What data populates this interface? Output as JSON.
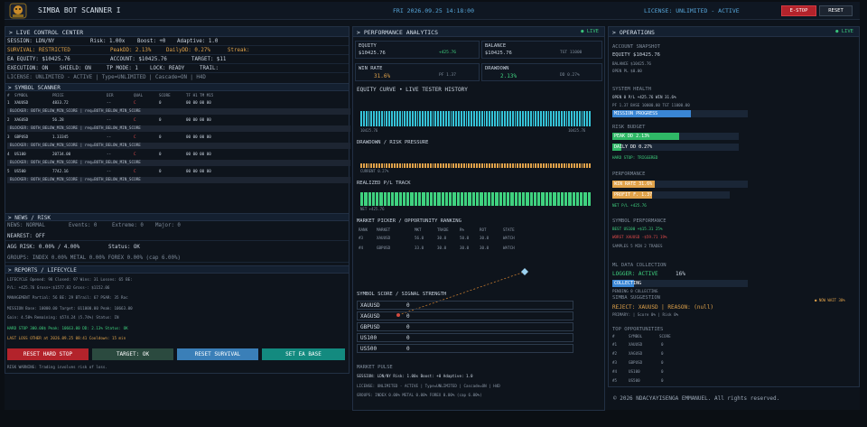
{
  "topbar": {
    "title": "SIMBA BOT SCANNER I",
    "clock": "FRI  2026.09.25  14:18:00",
    "license": "LICENSE: UNLIMITED - ACTIVE",
    "estop_label": "E-STOP",
    "reset_label": "RESET"
  },
  "live_control": {
    "header": "LIVE CONTROL CENTER",
    "session": "SESSION: LDN/NY",
    "risk": "Risk: 1.00x",
    "boost": "Boost: +0",
    "adaptive": "Adaptive: 1.0",
    "survival_label": "SURVIVAL:",
    "survival_value": "RESTRICTED",
    "peakdd": "PeakDD: 2.13%",
    "dailydd": "DailyDD: 0.27%",
    "streak": "Streak:",
    "ea_equity": "EA EQUITY: $10425.76",
    "account": "ACCOUNT: $10425.76",
    "target": "TARGET: $11",
    "execution": "EXECUTION: ON",
    "shield": "SHIELD: ON",
    "tp_mode": "TP MODE: 1",
    "lock": "LOCK: READY",
    "trail": "TRAIL:",
    "license_line": "LICENSE: UNLIMITED - ACTIVE | Type=UNLIMITED | Cascade=ON | H4D"
  },
  "symbol_scanner": {
    "header": "SYMBOL SCANNER",
    "columns": [
      "#",
      "SYMBOL",
      "PRICE",
      "DIR",
      "QUAL",
      "SCORE",
      "TF H1 TM M15"
    ],
    "rows": [
      {
        "n": "1",
        "symbol": "XAUUSD",
        "price": "4833.72",
        "dir": "--",
        "qual": "C",
        "score": "0",
        "tf": "00 00 00 00",
        "blocker": "BLOCKER: BOTH_BELOW_MIN_SCORE | req=BOTH_BELOW_MIN_SCORE"
      },
      {
        "n": "2",
        "symbol": "XAGUSD",
        "price": "56.28",
        "dir": "--",
        "qual": "C",
        "score": "0",
        "tf": "00 00 00 00",
        "blocker": "BLOCKER: BOTH_BELOW_MIN_SCORE | req=BOTH_BELOW_MIN_SCORE"
      },
      {
        "n": "3",
        "symbol": "GBPUSD",
        "price": "1.33345",
        "dir": "--",
        "qual": "C",
        "score": "0",
        "tf": "00 00 00 00",
        "blocker": "BLOCKER: BOTH_BELOW_MIN_SCORE | req=BOTH_BELOW_MIN_SCORE"
      },
      {
        "n": "4",
        "symbol": "US100",
        "price": "20734.00",
        "dir": "--",
        "qual": "C",
        "score": "0",
        "tf": "00 00 00 00",
        "blocker": "BLOCKER: BOTH_BELOW_MIN_SCORE | req=BOTH_BELOW_MIN_SCORE"
      },
      {
        "n": "5",
        "symbol": "US500",
        "price": "7742.16",
        "dir": "--",
        "qual": "C",
        "score": "0",
        "tf": "00 00 00 00",
        "blocker": "BLOCKER: BOTH_BELOW_MIN_SCORE | req=BOTH_BELOW_MIN_SCORE"
      }
    ]
  },
  "news": {
    "header": "NEWS / RISK",
    "news": "NEWS: NORMAL",
    "events": "Events: 0",
    "extreme": "Extreme: 0",
    "major": "Major: 0",
    "nearest": "NEAREST: OFF",
    "agg": "AGG RISK: 0.00% / 4.00%",
    "status": "Status: OK",
    "groups": "GROUPS: INDEX 0.00%   METAL 0.00%   FOREX 0.00%     (cap 6.00%)"
  },
  "reports": {
    "header": "REPORTS / LIFECYCLE",
    "lines": [
      "LIFECYCLE   Opened: 98    Closed: 97    Wins: 31    Losses: 65    BE:",
      "            P/L: +425.76     Gross+:$1577.82    Gross-: $1152.06",
      "MANAGEMENT    Partial: 56    BE: 29    BTrail: 67    PSAR: 35    Roc",
      "MISSION   Base: 10000.00    Target: 011000.00    Peak: 10663.00",
      "          Gain: 4.58%    Remaining: $574.24 (5.74%)    Status: IN",
      "HARD STOP    300.00$    Peak: 10663.00   DD: 2.13%    Status: OK"
    ],
    "last_loss": "LAST LOSS      OTHER at 2026.09.25 08:41      Cooldown: 15 min",
    "buttons": [
      "RESET HARD STOP",
      "TARGET: OK",
      "RESET SURVIVAL",
      "SET EA BASE"
    ],
    "warning": "RISK WARNING: Trading involves risk of loss."
  },
  "performance": {
    "header": "PERFORMANCE ANALYTICS",
    "live": "● LIVE",
    "equity_label": "EQUITY",
    "equity_value": "$10425.76",
    "equity_delta": "+425.76",
    "balance_label": "BALANCE",
    "balance_value": "$10425.76",
    "balance_sub": "TGT 11000",
    "winrate_label": "WIN RATE",
    "winrate_value": "31.6%",
    "winrate_sub": "PF 1.37",
    "drawdown_label": "DRAWDOWN",
    "drawdown_value": "2.13%",
    "drawdown_sub": "DD 0.27%",
    "equity_curve": "EQUITY CURVE  •  LIVE TESTER HISTORY",
    "curve_left": "10425.76",
    "curve_right": "10425.76",
    "drawdown_title": "DRAWDOWN / RISK PRESSURE",
    "drawdown_current": "CURRENT 0.27%",
    "pl_title": "REALIZED P/L TRACK",
    "pl_value": "NET +425.76",
    "ranking_title": "MARKET PICKER / OPPORTUNITY RANKING",
    "ranking_cols": [
      "RANK",
      "MARKET",
      "MKT",
      "TRADE",
      "R%",
      "ROT",
      "STATE"
    ],
    "ranking_rows": [
      [
        "#3",
        "XAUUSD",
        "56.0",
        "30.0",
        "50.0",
        "30.0",
        "WATCH"
      ],
      [
        "#4",
        "GBPUSD",
        "33.0",
        "30.0",
        "30.0",
        "30.0",
        "WATCH"
      ]
    ],
    "signal_title": "SYMBOL SCORE / SIGNAL STRENGTH",
    "signals": [
      {
        "symbol": "XAUUSD",
        "value": "0"
      },
      {
        "symbol": "XAGUSD",
        "value": "0"
      },
      {
        "symbol": "GBPUSD",
        "value": "0"
      },
      {
        "symbol": "US100",
        "value": "0"
      },
      {
        "symbol": "US500",
        "value": "0"
      }
    ],
    "pulse_title": "MARKET PULSE",
    "pulse_session": "SESSION: LDN/NY        Risk: 1.00x    Boost: +0    Adaptive: 1.0",
    "pulse_license": "LICENSE: UNLIMITED - ACTIVE | Type=UNLIMITED | Cascade=ON | H4D",
    "pulse_groups": "GROUPS: INDEX 0.00%   METAL 0.00%   FOREX 0.00%     (cap 6.00%)"
  },
  "operations": {
    "header": "OPERATIONS",
    "live": "● LIVE",
    "snapshot_title": "ACCOUNT SNAPSHOT",
    "equity": "EQUITY     $10425.76",
    "balance": "BALANCE    $10425.76",
    "open": "OPEN PL    $0.00",
    "health_title": "SYSTEM HEALTH",
    "health_line": "OPEN 0   P/L +425.76   WIN 31.6%",
    "health_line2": "PF 1.37     BASE 10000.00    TGT 11000.00",
    "mission_bar": "MISSION PROGRESS",
    "mission_pct": 0.58,
    "risk_title": "RISK BUDGET",
    "peak_dd": "PEAK DD    2.13%",
    "peak_pct": 0.53,
    "daily_dd": "DAILY DD   0.27%",
    "daily_pct": 0.07,
    "hard_stop": "HARD STOP: TRIGGERED",
    "perf_title": "PERFORMANCE",
    "win_rate": "WIN RATE   31.6%",
    "win_pct": 0.316,
    "pf": "PROFIT F.  1.37",
    "pf_pct": 0.34,
    "net": "NET P/L   +425.76",
    "symperf_title": "SYMBOL PERFORMANCE",
    "best": "BEST    US100     +$15.31    25%",
    "worst": "WORST   XAUUSD    -$59.71    19%",
    "samples": "SAMPLES 5    MIN 2 TRADES",
    "ml_title": "ML DATA COLLECTION",
    "logger": "LOGGER: ACTIVE",
    "logger_pct_text": "16%",
    "logger_pct": 0.16,
    "ml_bar": "COLLECTING",
    "ml_sub": "PENDING   0      COLLECTING",
    "suggestion_title": "SIMBA SUGGESTION",
    "suggestion_badge": "● NOW  WAIT 30%",
    "reject": "REJECT: XAUUSD | REASON: (null)",
    "primary": "PRIMARY: | Score 0% | Risk 0%",
    "top_title": "TOP OPPORTUNITIES",
    "top_cols": [
      "#",
      "SYMBOL",
      "SCORE"
    ],
    "top_rows": [
      [
        "#1",
        "XAUUSD",
        "0"
      ],
      [
        "#2",
        "XAGUSD",
        "0"
      ],
      [
        "#3",
        "GBPUSD",
        "0"
      ],
      [
        "#4",
        "US100",
        "0"
      ],
      [
        "#5",
        "US500",
        "0"
      ]
    ],
    "copyright": "© 2026 NDACYAYISENGA EMMANUEL. All rights reserved."
  },
  "colors": {
    "accent": "#57a6d9",
    "green": "#3fd27f",
    "orange": "#e0a24a",
    "red": "#b3232b",
    "cyan": "#35c3d8"
  }
}
